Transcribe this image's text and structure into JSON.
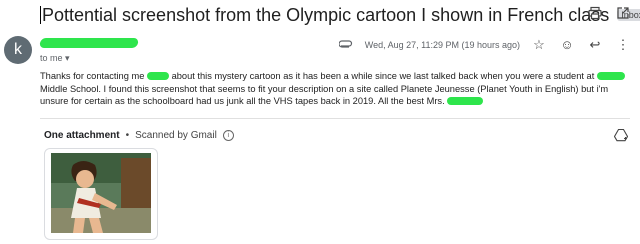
{
  "subject": "Pottential screenshot from the Olympic cartoon I shown in French class",
  "badge": {
    "label": "Inbox",
    "close": "×"
  },
  "avatar_letter": "k",
  "recipient": "to me",
  "date": "Wed, Aug 27, 11:29 PM (19 hours ago)",
  "body": {
    "part1": "Thanks for contacting me",
    "part2": "about this mystery cartoon as it has been a while since we last talked back when you were a student at",
    "part3": "Middle School. I found this screenshot that seems to fit your description on a site called Planete Jeunesse (Planet Youth in English) but i'm unsure for certain as the schoolboard had us junk all the VHS tapes back in 2019. All the best Mrs."
  },
  "attachments": {
    "count_label": "One attachment",
    "separator": "•",
    "scan_label": "Scanned by Gmail",
    "info": "i"
  },
  "icons": {
    "print": "print-icon",
    "open_new": "open-in-new-icon",
    "star": "star-icon",
    "emoji": "emoji-icon",
    "reply": "reply-icon",
    "more": "more-vert-icon",
    "attachment_clip": "paperclip-icon",
    "add_to_drive": "add-to-drive-icon"
  },
  "colors": {
    "redaction": "#2ee54c"
  }
}
